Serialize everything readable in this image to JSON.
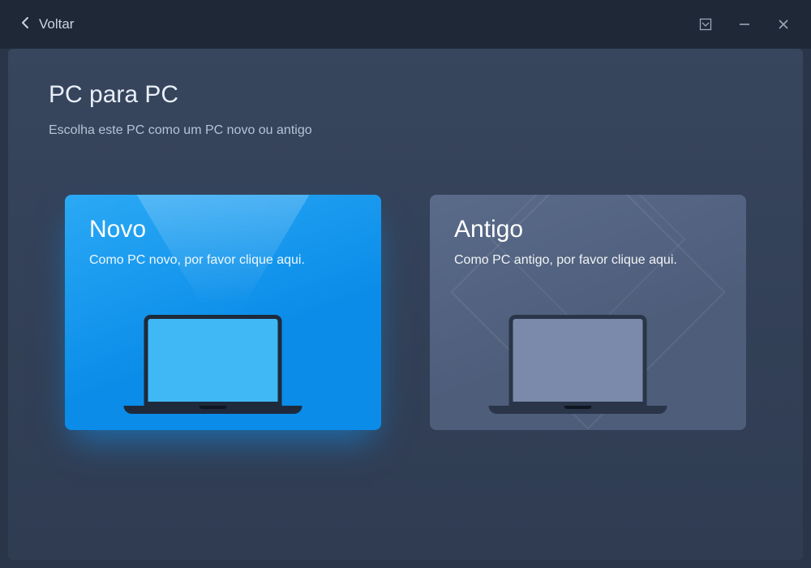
{
  "titlebar": {
    "back_label": "Voltar"
  },
  "page": {
    "title": "PC para PC",
    "subtitle": "Escolha este PC como um PC novo ou antigo"
  },
  "cards": {
    "new": {
      "title": "Novo",
      "subtitle": "Como PC novo, por favor clique aqui."
    },
    "old": {
      "title": "Antigo",
      "subtitle": "Como PC antigo, por favor clique aqui."
    }
  }
}
